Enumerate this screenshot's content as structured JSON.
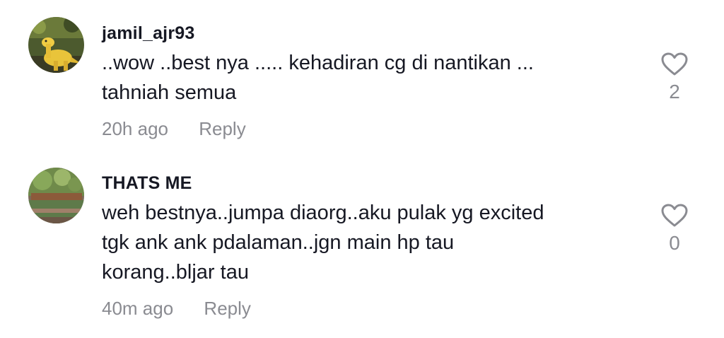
{
  "comments": [
    {
      "username": "jamil_ajr93",
      "text": "..wow ..best nya ..... kehadiran cg di nantikan ...\ntahniah semua",
      "time": "20h ago",
      "reply_label": "Reply",
      "likes": "2",
      "avatar_icon": "dinosaur-toy-photo"
    },
    {
      "username": "THATS ME",
      "text": "weh bestnya..jumpa diaorg..aku pulak yg excited\ntgk ank ank pdalaman..jgn main hp tau\nkorang..bljar tau",
      "time": "40m ago",
      "reply_label": "Reply",
      "likes": "0",
      "avatar_icon": "garden-planter-photo"
    }
  ]
}
